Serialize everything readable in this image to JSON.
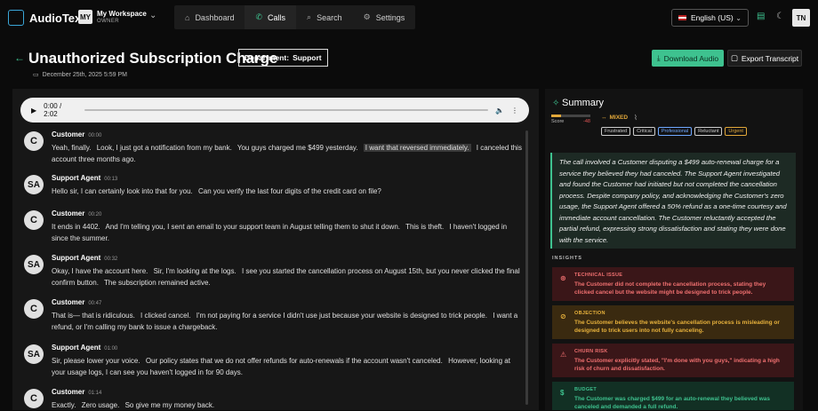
{
  "app": {
    "name": "AudioText"
  },
  "workspace": {
    "initials": "MY",
    "name": "My Workspace",
    "role": "OWNER"
  },
  "nav": [
    {
      "label": "Dashboard",
      "icon": "home-icon"
    },
    {
      "label": "Calls",
      "icon": "phone-icon"
    },
    {
      "label": "Search",
      "icon": "search-icon"
    },
    {
      "label": "Settings",
      "icon": "gear-icon"
    }
  ],
  "language": {
    "selected": "English (US)"
  },
  "user": {
    "initials": "TN"
  },
  "page": {
    "title": "Unauthorized Subscription Charge",
    "department_label": "Department:",
    "department_value": "Support",
    "date": "December 25th, 2025 5:59 PM",
    "download_label": "Download Audio",
    "export_label": "Export Transcript"
  },
  "audio": {
    "time": "0:00 / 2:02"
  },
  "transcript": [
    {
      "initials": "C",
      "speaker": "Customer",
      "time": "00:00",
      "segments": [
        "Yeah, finally.",
        "Look, I just got a notification from my bank.",
        "You guys charged me $499 yesterday.",
        "I want that reversed immediately.",
        "I canceled this account three months ago."
      ],
      "highlight": 3
    },
    {
      "initials": "SA",
      "speaker": "Support Agent",
      "time": "00:13",
      "segments": [
        "Hello sir, I can certainly look into that for you.",
        "Can you verify the last four digits of the credit card on file?"
      ],
      "highlight": -1
    },
    {
      "initials": "C",
      "speaker": "Customer",
      "time": "00:20",
      "segments": [
        "It ends in 4402.",
        "And I'm telling you, I sent an email to your support team in August telling them to shut it down.",
        "This is theft.",
        "I haven't logged in since the summer."
      ],
      "highlight": -1
    },
    {
      "initials": "SA",
      "speaker": "Support Agent",
      "time": "00:32",
      "segments": [
        "Okay, I have the account here.",
        "Sir, I'm looking at the logs.",
        "I see you started the cancellation process on August 15th, but you never clicked the final confirm button.",
        "The subscription remained active."
      ],
      "highlight": -1
    },
    {
      "initials": "C",
      "speaker": "Customer",
      "time": "00:47",
      "segments": [
        "That is— that is ridiculous.",
        "I clicked cancel.",
        "I'm not paying for a service I didn't use just because your website is designed to trick people.",
        "I want a refund, or I'm calling my bank to issue a chargeback."
      ],
      "highlight": -1
    },
    {
      "initials": "SA",
      "speaker": "Support Agent",
      "time": "01:00",
      "segments": [
        "Sir, please lower your voice.",
        "Our policy states that we do not offer refunds for auto-renewals if the account wasn't canceled.",
        "However, looking at your usage logs, I can see you haven't logged in for 90 days."
      ],
      "highlight": -1
    },
    {
      "initials": "C",
      "speaker": "Customer",
      "time": "01:14",
      "segments": [
        "Exactly.",
        "Zero usage.",
        "So give me my money back."
      ],
      "highlight": -1
    }
  ],
  "summary": {
    "title": "Summary",
    "score_label": "Score",
    "score_value": "-48",
    "score_fill": 0.26,
    "sentiment": "MIXED",
    "tags": [
      {
        "label": "Frustrated",
        "color": "#cccccc"
      },
      {
        "label": "Critical",
        "color": "#cccccc"
      },
      {
        "label": "Professional",
        "color": "#6fa8ff"
      },
      {
        "label": "Reluctant",
        "color": "#cccccc"
      },
      {
        "label": "Urgent",
        "color": "#e2a83a"
      }
    ],
    "text": "The call involved a Customer disputing a $499 auto-renewal charge for a service they believed they had canceled. The Support Agent investigated and found the Customer had initiated but not completed the cancellation process. Despite company policy, and acknowledging the Customer's zero usage, the Support Agent offered a 50% refund as a one-time courtesy and immediate account cancellation. The Customer reluctantly accepted the partial refund, expressing strong dissatisfaction and stating they were done with the service."
  },
  "insights": {
    "label": "INSIGHTS",
    "items": [
      {
        "type": "TECHNICAL ISSUE",
        "icon": "alert-circle-icon",
        "text": "The Customer did not complete the cancellation process, stating they clicked cancel but the website might be designed to trick people.",
        "bg": "#3a1618",
        "color": "#f07070"
      },
      {
        "type": "OBJECTION",
        "icon": "ban-icon",
        "text": "The Customer believes the website's cancellation process is misleading or designed to trick users into not fully canceling.",
        "bg": "#3a2a10",
        "color": "#e8b23c"
      },
      {
        "type": "CHURN RISK",
        "icon": "warning-icon",
        "text": "The Customer explicitly stated, \"I'm done with you guys,\" indicating a high risk of churn and dissatisfaction.",
        "bg": "#3a1618",
        "color": "#f07070"
      },
      {
        "type": "BUDGET",
        "icon": "dollar-icon",
        "text": "The Customer was charged $499 for an auto-renewal they believed was canceled and demanded a full refund.",
        "bg": "#123024",
        "color": "#3ec28f"
      }
    ]
  }
}
